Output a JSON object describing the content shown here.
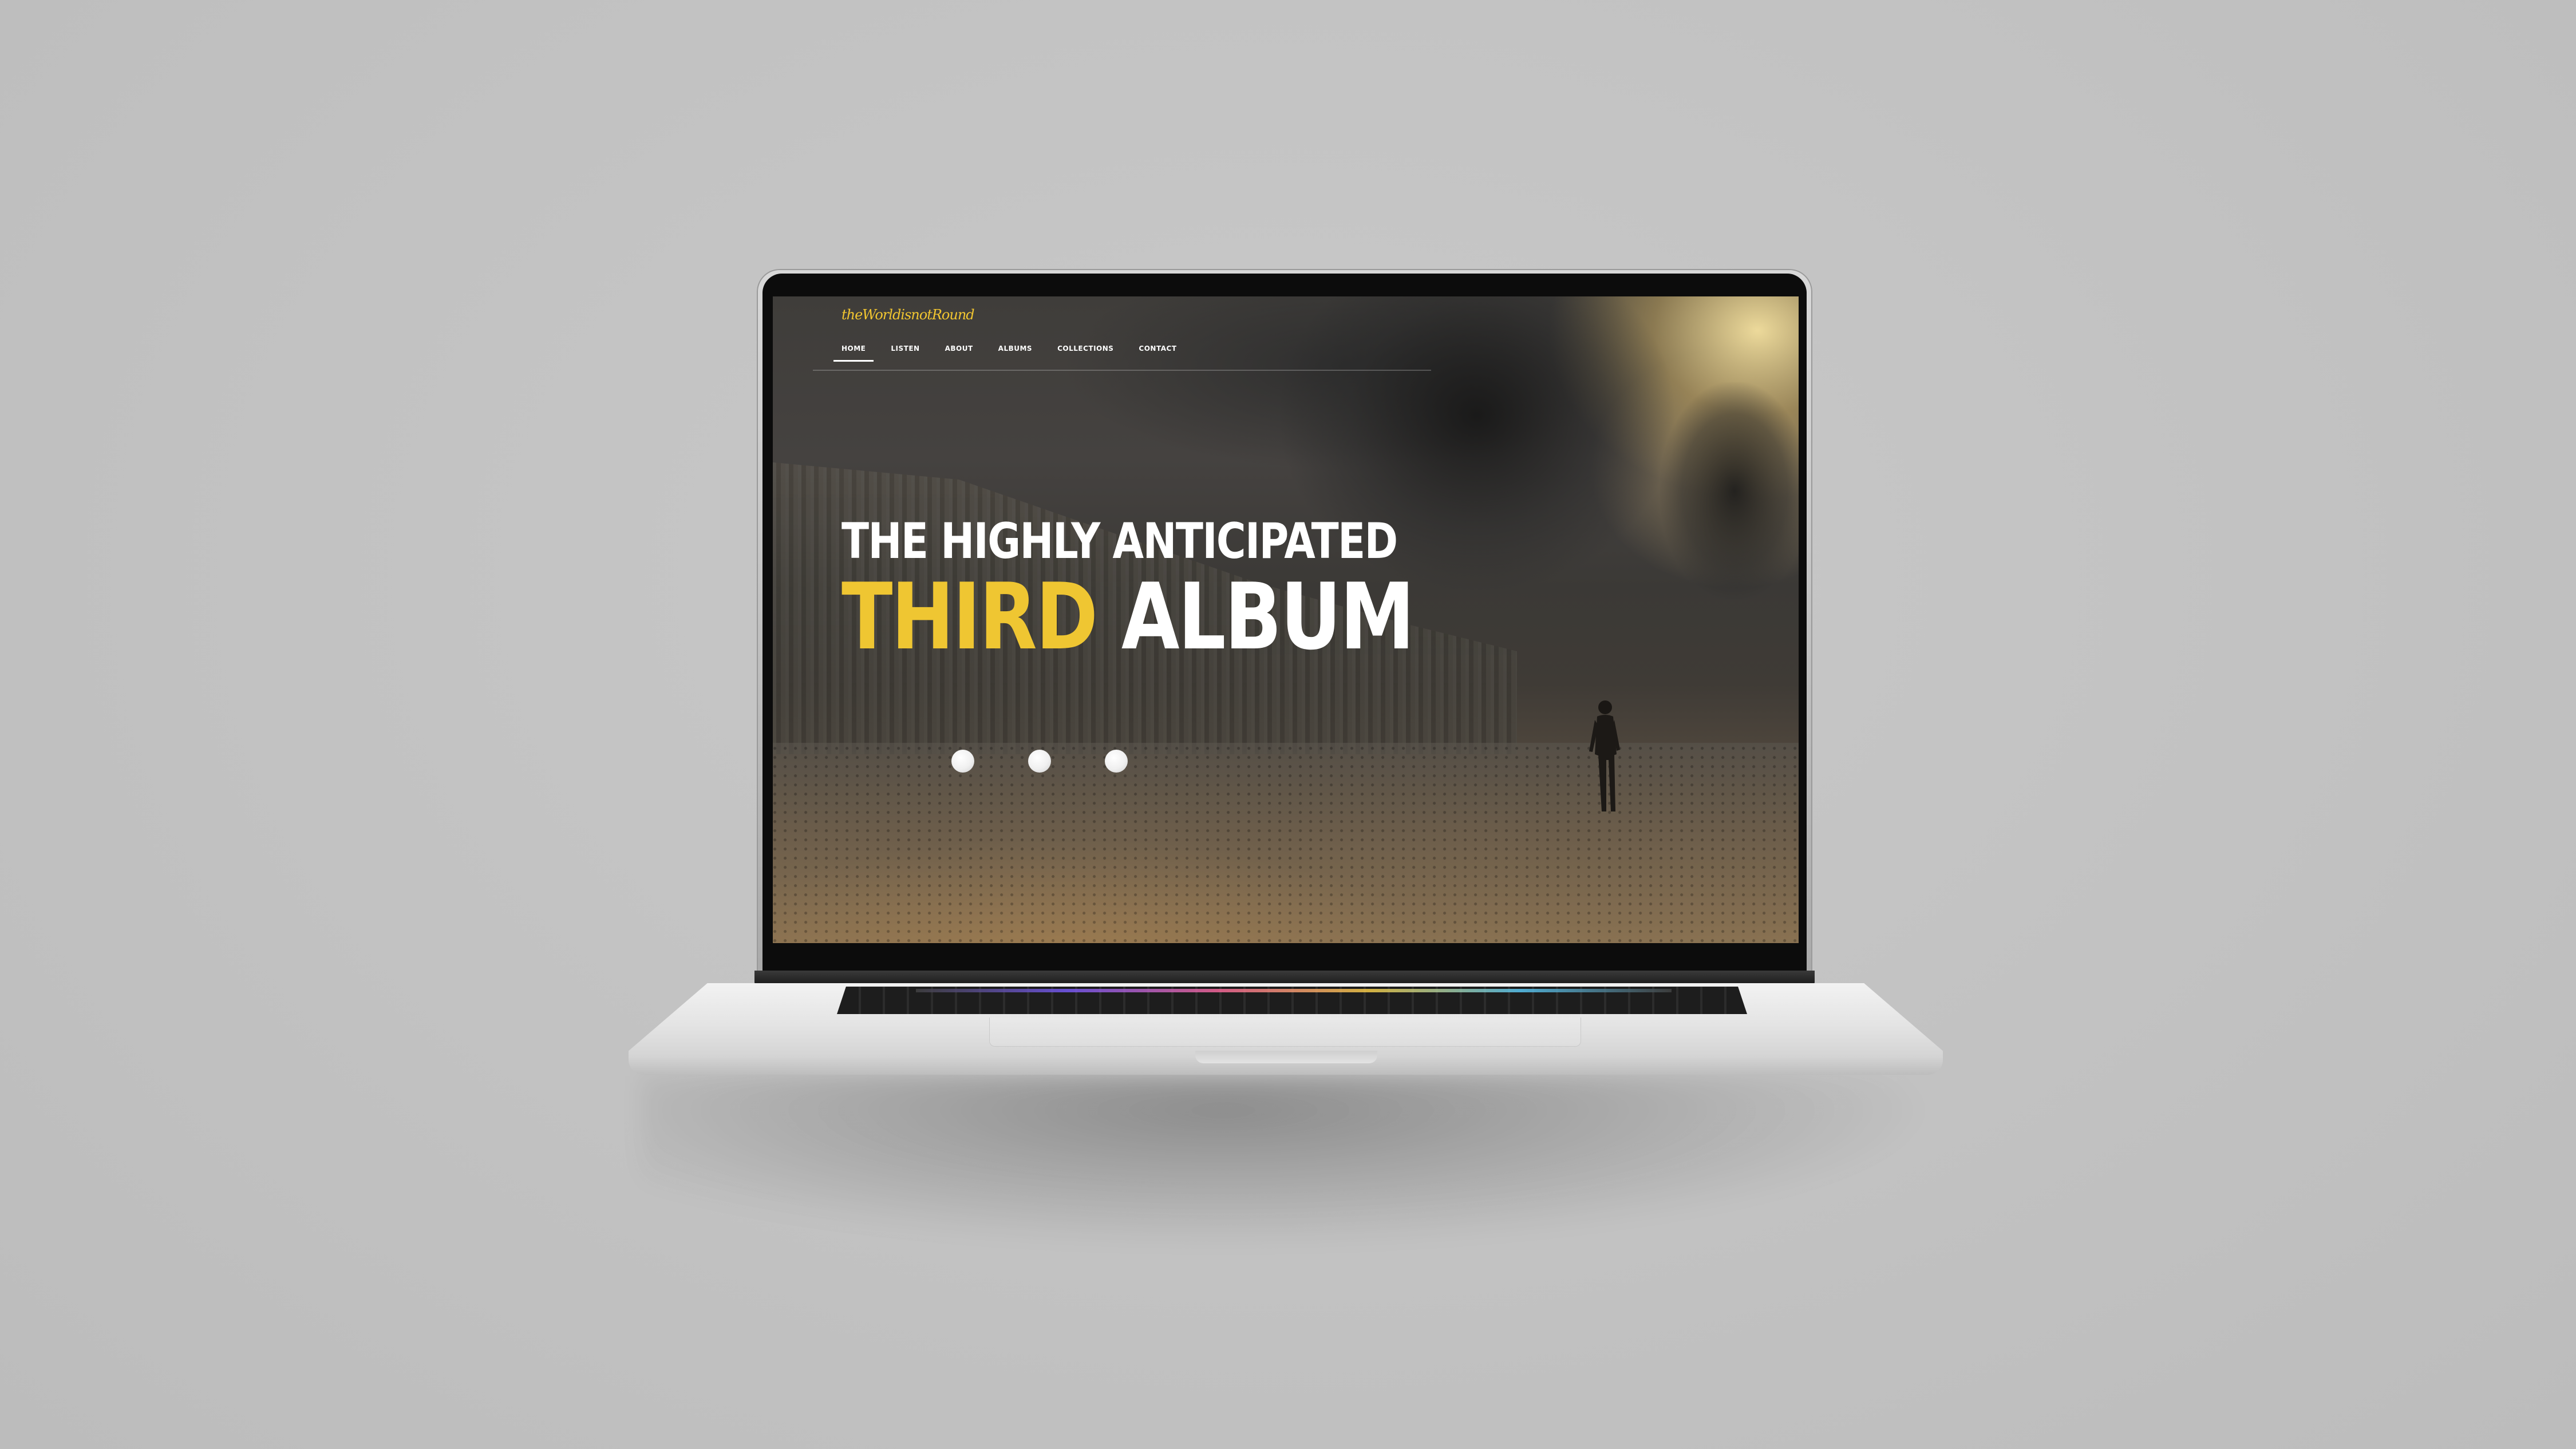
{
  "site": {
    "logo_text": "theWorldisnotRound",
    "nav": {
      "items": [
        {
          "label": "HOME",
          "active": true
        },
        {
          "label": "LISTEN",
          "active": false
        },
        {
          "label": "ABOUT",
          "active": false
        },
        {
          "label": "ALBUMS",
          "active": false
        },
        {
          "label": "COLLECTIONS",
          "active": false
        },
        {
          "label": "CONTACT",
          "active": false
        }
      ]
    },
    "hero": {
      "line1": "THE HIGHLY ANTICIPATED",
      "line2_accent": "THIRD",
      "line2_rest": "ALBUM"
    },
    "carousel": {
      "dot_count": 3
    }
  },
  "colors": {
    "accent": "#efc632",
    "text": "#ffffff",
    "wall": "#c2c2c2"
  }
}
